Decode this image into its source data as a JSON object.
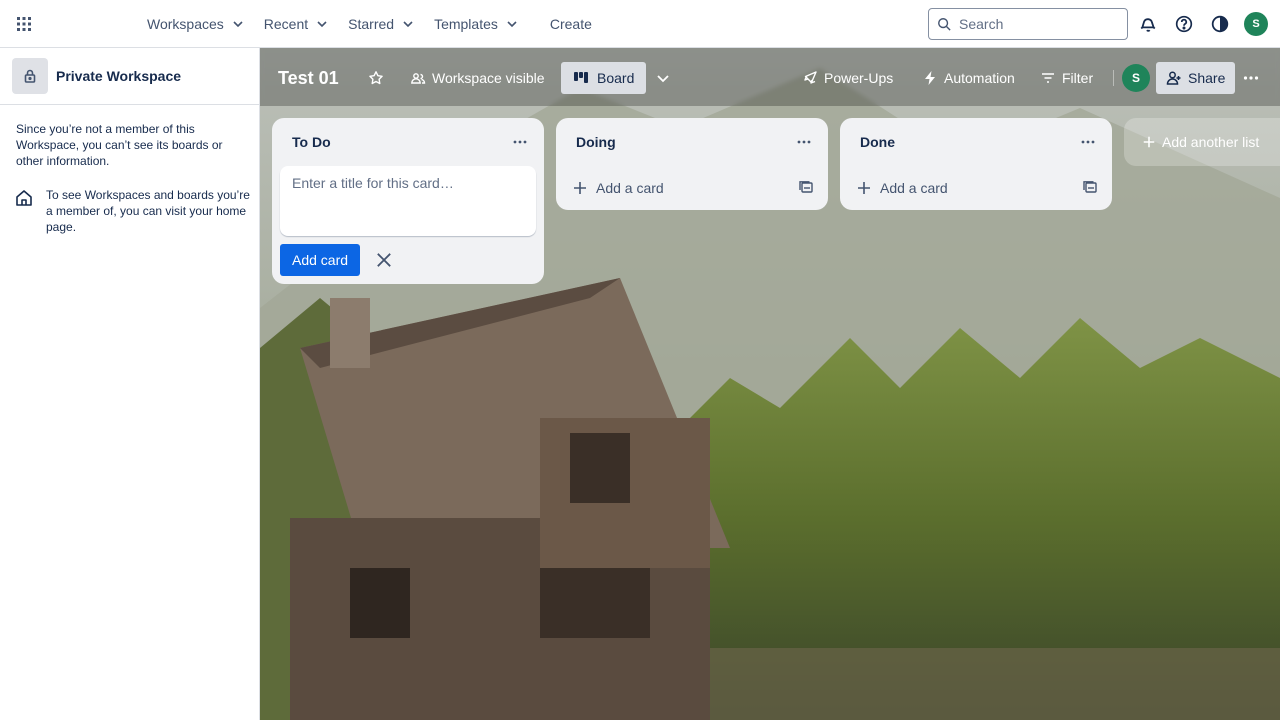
{
  "topnav": {
    "menu": [
      {
        "label": "Workspaces"
      },
      {
        "label": "Recent"
      },
      {
        "label": "Starred"
      },
      {
        "label": "Templates"
      }
    ],
    "create_label": "Create",
    "search_placeholder": "Search",
    "user_initial": "S"
  },
  "sidebar": {
    "workspace_name": "Private Workspace",
    "notice": "Since you’re not a member of this Workspace, you can’t see its boards or other information.",
    "home_hint": "To see Workspaces and boards you’re a member of, you can visit your home page."
  },
  "board": {
    "title": "Test 01",
    "visibility_label": "Workspace visible",
    "view_label": "Board",
    "powerups_label": "Power-Ups",
    "automation_label": "Automation",
    "filter_label": "Filter",
    "member_initial": "S",
    "share_label": "Share"
  },
  "lists": [
    {
      "title": "To Do",
      "composer_placeholder": "Enter a title for this card…",
      "add_card_button": "Add card"
    },
    {
      "title": "Doing",
      "add_card_label": "Add a card"
    },
    {
      "title": "Done",
      "add_card_label": "Add a card"
    }
  ],
  "add_list_label": "Add another list",
  "colors": {
    "accent": "#0c66e4",
    "avatar": "#1f845a",
    "list_bg": "#f1f2f4"
  }
}
